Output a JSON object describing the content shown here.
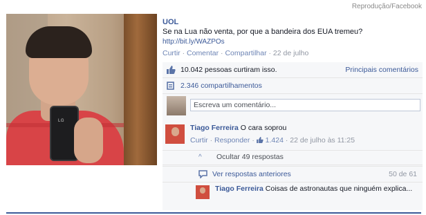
{
  "credit": "Reprodução/Facebook",
  "photo": {
    "phone_brand": "LG"
  },
  "post": {
    "author": "UOL",
    "text": "Se na Lua não venta, por que a bandeira dos EUA tremeu?",
    "link": "http://bit.ly/WAZPOs",
    "actions": {
      "like": "Curtir",
      "comment": "Comentar",
      "share": "Compartilhar",
      "date": "22 de julho",
      "separator": "·"
    }
  },
  "likes": {
    "text": "10.042 pessoas curtiram isso.",
    "top_comments": "Principais comentários"
  },
  "shares": {
    "text": "2.346 compartilhamentos"
  },
  "compose": {
    "placeholder": "Escreva um comentário..."
  },
  "comment": {
    "author": "Tiago Ferreira",
    "text": "O cara soprou",
    "like": "Curtir",
    "reply": "Responder",
    "like_count": "1.424",
    "timestamp": "22 de julho às 11:25",
    "separator": "·"
  },
  "replies": {
    "hide_label": "Ocultar 49 respostas",
    "view_previous": "Ver respostas anteriores",
    "counter": "50 de 61",
    "reply_author": "Tiago Ferreira",
    "reply_text": "Coisas de astronautas que ninguém explica..."
  },
  "colors": {
    "link": "#3b5998",
    "meta": "#9197a3",
    "panel": "#f6f7f9"
  }
}
